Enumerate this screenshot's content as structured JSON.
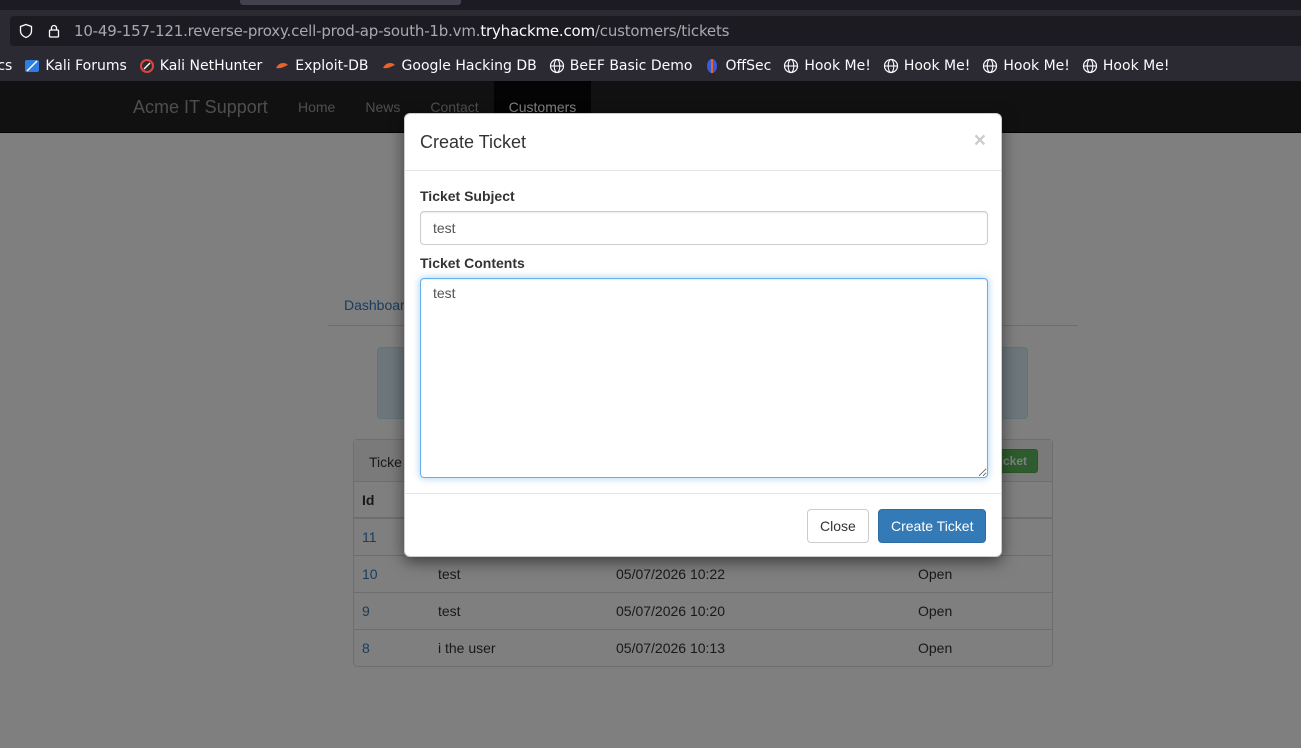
{
  "browser": {
    "url_prefix": "10-49-157-121.reverse-proxy.cell-prod-ap-south-1b.vm.",
    "url_host": "tryhackme.com",
    "url_path": "/customers/tickets",
    "bookmarks": [
      {
        "label": "Docs",
        "icon": "docs-icon"
      },
      {
        "label": "Kali Forums",
        "icon": "kali-forums-icon"
      },
      {
        "label": "Kali NetHunter",
        "icon": "kali-nethunter-icon"
      },
      {
        "label": "Exploit-DB",
        "icon": "exploit-db-icon"
      },
      {
        "label": "Google Hacking DB",
        "icon": "google-hacking-db-icon"
      },
      {
        "label": "BeEF Basic Demo",
        "icon": "globe-icon"
      },
      {
        "label": "OffSec",
        "icon": "offsec-icon"
      },
      {
        "label": "Hook Me!",
        "icon": "globe-icon"
      },
      {
        "label": "Hook Me!",
        "icon": "globe-icon"
      },
      {
        "label": "Hook Me!",
        "icon": "globe-icon"
      },
      {
        "label": "Hook Me!",
        "icon": "globe-icon"
      }
    ]
  },
  "navbar": {
    "brand": "Acme IT Support",
    "links": [
      {
        "label": "Home",
        "active": false
      },
      {
        "label": "News",
        "active": false
      },
      {
        "label": "Contact",
        "active": false
      },
      {
        "label": "Customers",
        "active": true
      }
    ]
  },
  "page": {
    "tab_label": "Dashboar",
    "panel_title": "Ticke",
    "new_ticket_label": "icket",
    "table": {
      "headers": [
        "Id",
        "",
        "",
        ""
      ],
      "rows": [
        {
          "id": "11",
          "subject": "",
          "date": "",
          "status": ""
        },
        {
          "id": "10",
          "subject": "test",
          "date": "05/07/2026 10:22",
          "status": "Open"
        },
        {
          "id": "9",
          "subject": "test",
          "date": "05/07/2026 10:20",
          "status": "Open"
        },
        {
          "id": "8",
          "subject": "i the user",
          "date": "05/07/2026 10:13",
          "status": "Open"
        }
      ]
    }
  },
  "modal": {
    "title": "Create Ticket",
    "close_glyph": "×",
    "subject_label": "Ticket Subject",
    "subject_value": "test",
    "contents_label": "Ticket Contents",
    "contents_value": "test",
    "close_button": "Close",
    "create_button": "Create Ticket"
  },
  "colors": {
    "navbar_bg": "#222222",
    "primary": "#337ab7",
    "success": "#5cb85c",
    "focus_border": "#66afe9"
  }
}
